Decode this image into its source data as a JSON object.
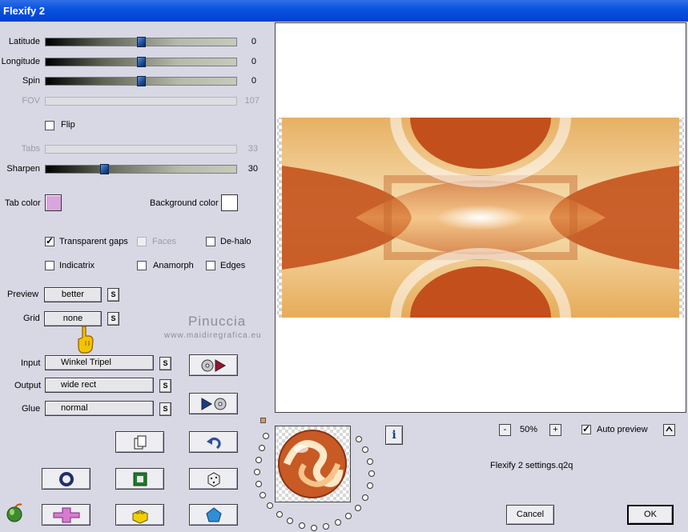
{
  "window": {
    "title": "Flexify 2"
  },
  "sliders": {
    "latitude": {
      "label": "Latitude",
      "value": "0",
      "level": 0.5
    },
    "longitude": {
      "label": "Longitude",
      "value": "0",
      "level": 0.5
    },
    "spin": {
      "label": "Spin",
      "value": "0",
      "level": 0.5
    },
    "fov": {
      "label": "FOV",
      "value": "107",
      "level": 0.3
    },
    "tabs": {
      "label": "Tabs",
      "value": "33",
      "level": 0.33
    },
    "sharpen": {
      "label": "Sharpen",
      "value": "30",
      "level": 0.3
    }
  },
  "flip": {
    "label": "Flip",
    "checked": false
  },
  "colors": {
    "tab_color": {
      "label": "Tab color",
      "value": "#d8a6dc"
    },
    "background_color": {
      "label": "Background color",
      "value": "#ffffff"
    }
  },
  "options": {
    "transparent_gaps": {
      "label": "Transparent gaps",
      "checked": true
    },
    "faces": {
      "label": "Faces",
      "checked": false
    },
    "de_halo": {
      "label": "De-halo",
      "checked": false
    },
    "indicatrix": {
      "label": "Indicatrix",
      "checked": false
    },
    "anamorph": {
      "label": "Anamorph",
      "checked": false
    },
    "edges": {
      "label": "Edges",
      "checked": false
    }
  },
  "preview_quality": {
    "label": "Preview",
    "value": "better"
  },
  "grid": {
    "label": "Grid",
    "value": "none"
  },
  "projection": {
    "input": {
      "label": "Input",
      "value": "Winkel Tripel"
    },
    "output": {
      "label": "Output",
      "value": "wide rect"
    },
    "glue": {
      "label": "Glue",
      "value": "normal"
    }
  },
  "s_button_label": "S",
  "watermark": {
    "name": "Pinuccia",
    "url": "www.maidiregrafica.eu"
  },
  "zoom": {
    "minus": "-",
    "value": "50%",
    "plus": "+"
  },
  "auto_preview": {
    "label": "Auto preview",
    "checked": true
  },
  "settings_file": "Flexify 2 settings.q2q",
  "info_label": "i",
  "buttons": {
    "cancel": "Cancel",
    "ok": "OK"
  }
}
